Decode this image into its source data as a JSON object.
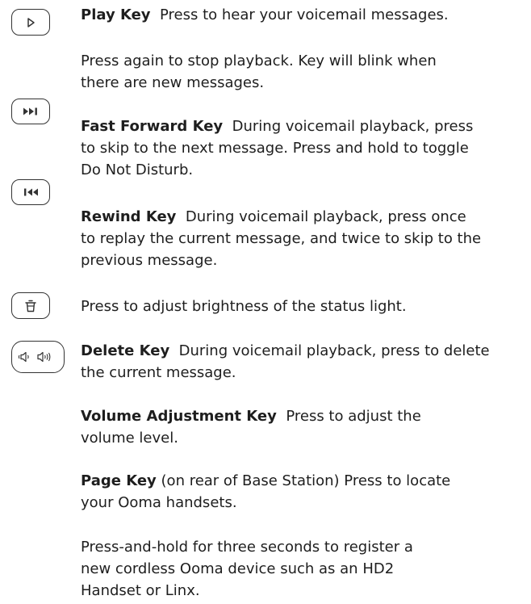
{
  "icons": {
    "play": "play-icon",
    "fast_forward": "fast-forward-icon",
    "rewind": "rewind-icon",
    "delete": "trash-icon",
    "volume": "volume-icon"
  },
  "play": {
    "label": "Play Key",
    "line1": "Press to hear your voicemail messages."
  },
  "play_stop": {
    "line1": "Press again to stop playback. Key will blink when",
    "line2": "there are new messages."
  },
  "fast_forward": {
    "label": "Fast Forward Key",
    "line1": "During voicemail playback, press",
    "line2": "to skip to the next message. Press and hold to toggle",
    "line3": "Do Not Disturb."
  },
  "rewind": {
    "label": "Rewind Key",
    "line1": "During voicemail playback, press once",
    "line2": "to replay the current message, and twice to skip to the",
    "line3": "previous message."
  },
  "brightness": {
    "line1": "Press to adjust brightness of the status light."
  },
  "delete": {
    "label": "Delete Key",
    "line1": "During voicemail playback, press to delete",
    "line2": "the current message."
  },
  "volume": {
    "label": "Volume Adjustment Key",
    "line1": "Press to adjust the",
    "line2": "volume level."
  },
  "page": {
    "label": "Page Key",
    "line1": "(on rear of Base Station)  Press to locate",
    "line2": "your Ooma handsets."
  },
  "register": {
    "line1": "Press-and-hold for three seconds to register a",
    "line2": "new cordless Ooma device such as an HD2",
    "line3": "Handset or Linx."
  }
}
